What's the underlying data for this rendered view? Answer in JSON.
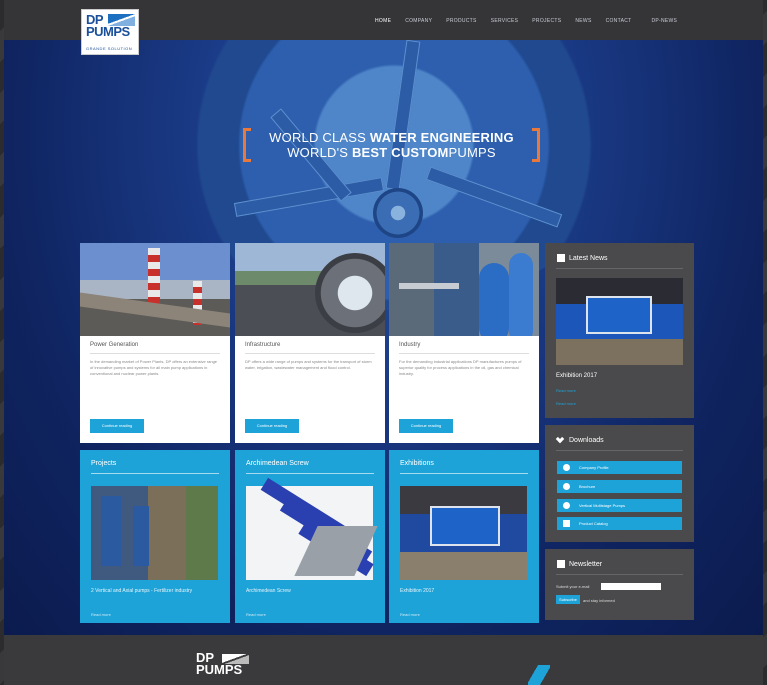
{
  "brand": {
    "logo_text_1": "DP",
    "logo_text_2": "PUMPS",
    "logo_tagline": "GRANDE SOLUTION"
  },
  "nav": {
    "items": [
      "HOME",
      "COMPANY",
      "PRODUCTS",
      "SERVICES",
      "PROJECTS",
      "NEWS",
      "CONTACT",
      "DP-NEWS"
    ],
    "active": "HOME"
  },
  "hero": {
    "line1_plain": "WORLD CLASS",
    "line1_bold": "WATER ENGINEERING",
    "line2_plain_a": "WORLD'S",
    "line2_bold": "BEST CUSTOM",
    "line2_plain_b": "PUMPS"
  },
  "cards": [
    {
      "title": "Power Generation",
      "text": "In the demanding market of Power Plants, DP offers an extensive range of innovative pumps and systems for all main pump applications in conventional and nuclear power plants.",
      "button": "Continue reading"
    },
    {
      "title": "Infrastructure",
      "text": "DP offers a wide range of pumps and systems for the transport of storm water, irrigation, wastewater management and flood control.",
      "button": "Continue reading"
    },
    {
      "title": "Industry",
      "text": "For the demanding industrial applications DP manufactures pumps of superior quality for process applications in the oil, gas and chemical industry.",
      "button": "Continue reading"
    }
  ],
  "tiles": [
    {
      "title": "Projects",
      "caption": "2 Vertical and Axial pumps - Fertilizer industry",
      "link": "Read more"
    },
    {
      "title": "Archimedean Screw",
      "caption": "Archimedean Screw",
      "link": "Read more"
    },
    {
      "title": "Exhibitions",
      "caption": "Exhibition 2017",
      "link": "Read more"
    }
  ],
  "sidebar": {
    "news": {
      "title": "Latest News",
      "caption": "Exhibition 2017",
      "link_1": "Read more",
      "link_2": "Read more"
    },
    "downloads": {
      "title": "Downloads",
      "items": [
        "Company Profile",
        "Brochure",
        "Vertical Multistage Pumps",
        "Product Catalog"
      ]
    },
    "newsletter": {
      "title": "Newsletter",
      "label": "Submit your e-mail",
      "input_placeholder": "",
      "submit": "Subscribe",
      "note": "and stay informed"
    }
  },
  "colors": {
    "accent_blue": "#1ea3d8",
    "bracket_orange": "#e8793a",
    "hero_dark_blue": "#0f2460"
  }
}
